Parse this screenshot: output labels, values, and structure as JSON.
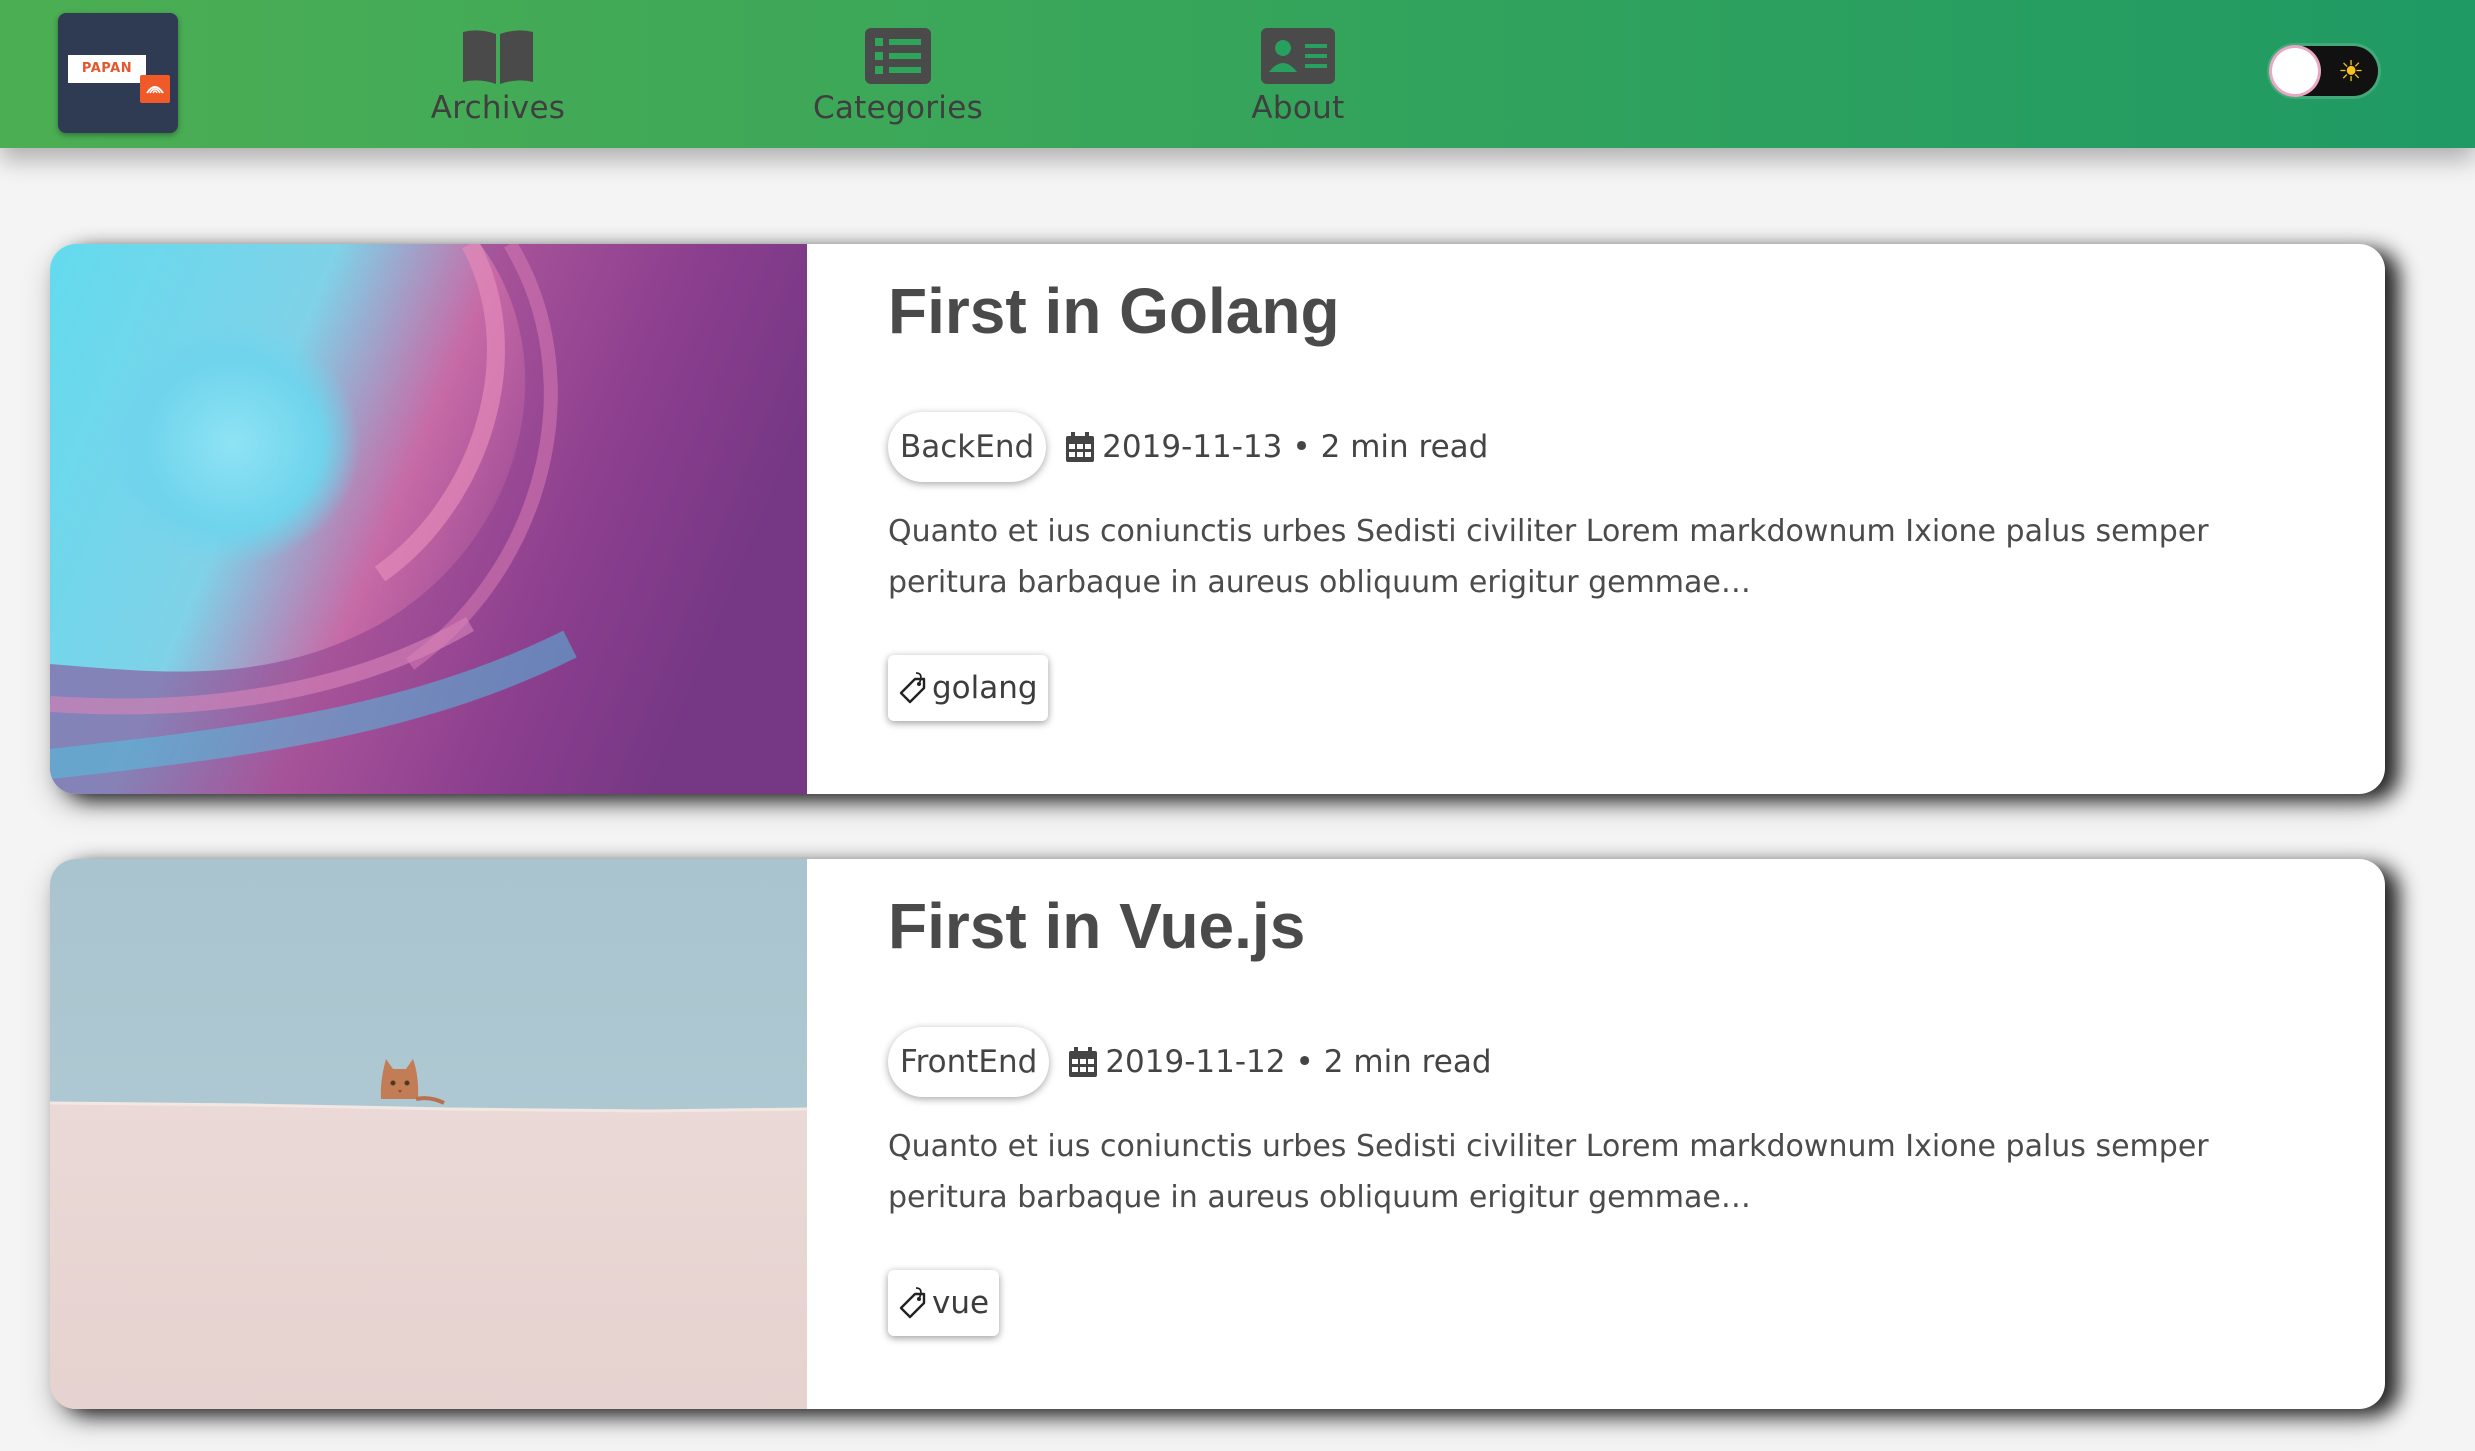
{
  "header": {
    "logo_text": "PAPAN",
    "nav": [
      {
        "label": "Archives",
        "icon": "book-open-icon"
      },
      {
        "label": "Categories",
        "icon": "list-icon"
      },
      {
        "label": "About",
        "icon": "id-card-icon"
      }
    ],
    "theme_toggle": {
      "state": "light",
      "icon": "sun-icon",
      "symbol": "☀"
    }
  },
  "posts": [
    {
      "title": "First in Golang",
      "category": "BackEnd",
      "date": "2019-11-13",
      "separator": "•",
      "read_time": "2 min read",
      "excerpt": "Quanto et ius coniunctis urbes Sedisti civiliter Lorem markdownum Ixione palus semper peritura barbaque in aureus obliquum erigitur gemmae…",
      "tags": [
        "golang"
      ],
      "image": "ocean-wave-image"
    },
    {
      "title": "First in Vue.js",
      "category": "FrontEnd",
      "date": "2019-11-12",
      "separator": "•",
      "read_time": "2 min read",
      "excerpt": "Quanto et ius coniunctis urbes Sedisti civiliter Lorem markdownum Ixione palus semper peritura barbaque in aureus obliquum erigitur gemmae…",
      "tags": [
        "vue"
      ],
      "image": "cat-behind-wall-image"
    }
  ],
  "colors": {
    "header_gradient_start": "#4cae53",
    "header_gradient_end": "#1f9a64",
    "page_background": "#f4f4f4",
    "text": "#4a4a4a"
  }
}
